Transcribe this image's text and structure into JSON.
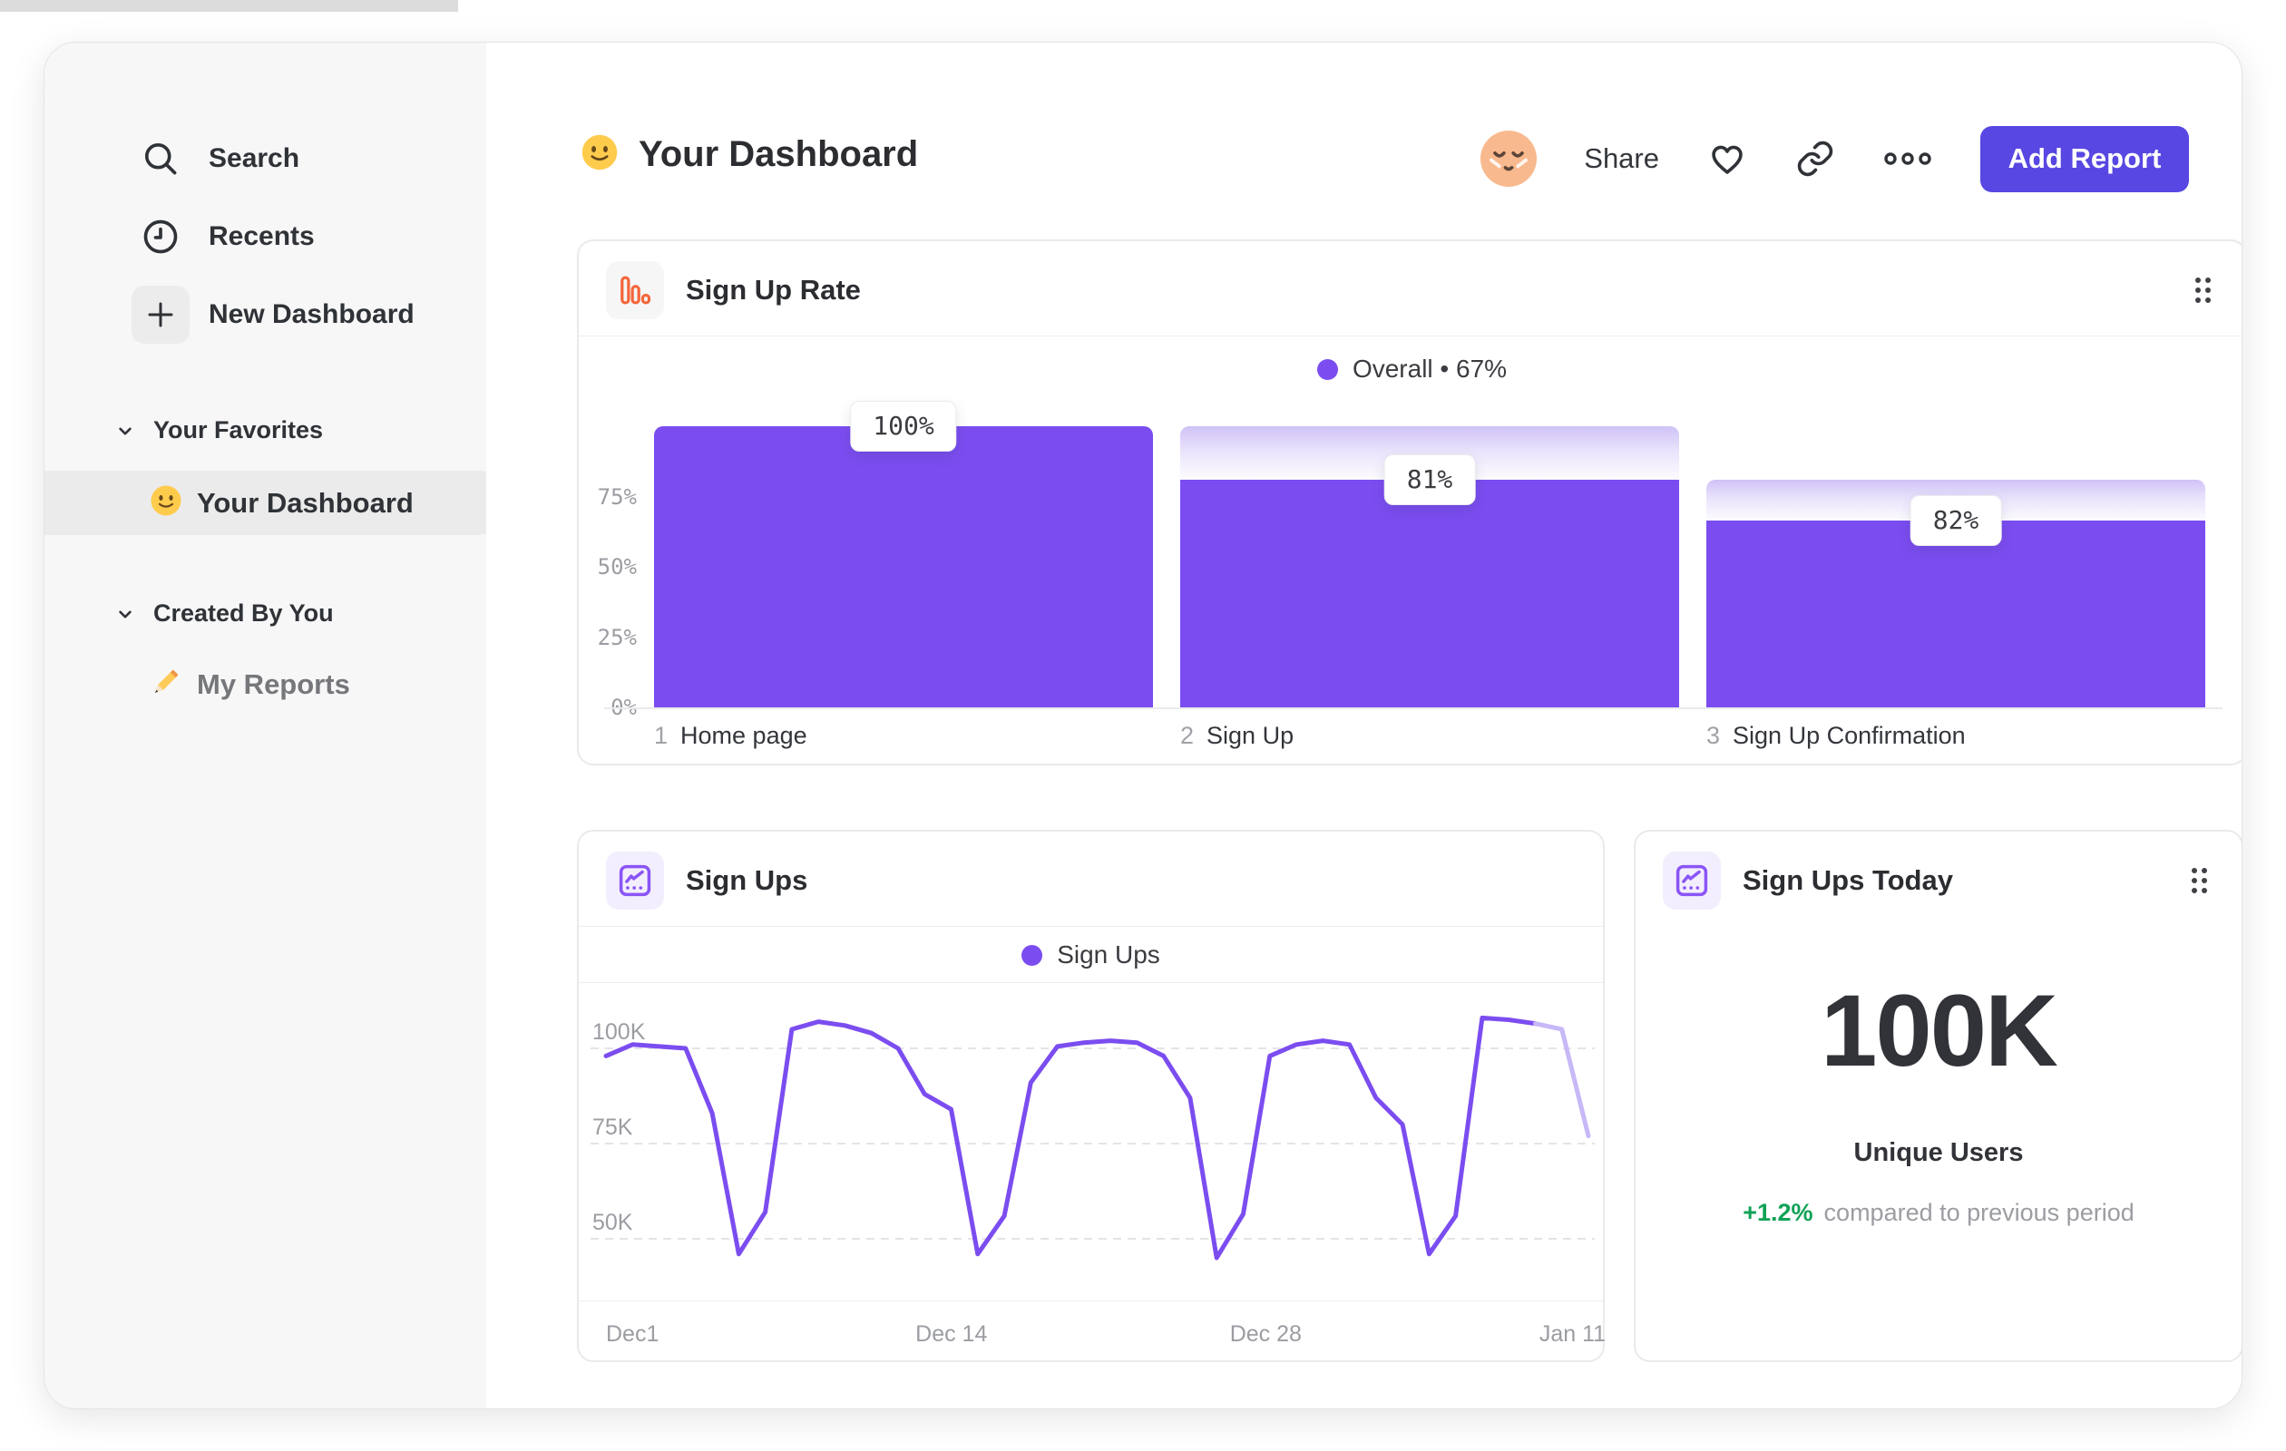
{
  "sidebar": {
    "nav": [
      {
        "icon": "search-icon",
        "label": "Search"
      },
      {
        "icon": "clock-icon",
        "label": "Recents"
      },
      {
        "icon": "plus-icon",
        "label": "New Dashboard"
      }
    ],
    "sections": [
      {
        "title": "Your Favorites",
        "items": [
          {
            "icon": "smiley-emoji",
            "label": "Your Dashboard",
            "selected": true
          }
        ]
      },
      {
        "title": "Created By You",
        "items": [
          {
            "icon": "pencil-emoji",
            "label": "My Reports",
            "selected": false
          }
        ]
      }
    ]
  },
  "header": {
    "icon": "smiley-emoji",
    "title": "Your Dashboard",
    "share": "Share",
    "add_report": "Add Report"
  },
  "funnel_card": {
    "icon": "bar-chart-icon",
    "title": "Sign Up Rate"
  },
  "line_card": {
    "icon": "insights-icon",
    "title": "Sign Ups"
  },
  "kpi_card": {
    "icon": "insights-icon",
    "title": "Sign Ups Today",
    "value": "100K",
    "metric": "Unique Users",
    "delta": "+1.2%",
    "delta_caption": "compared to previous period"
  },
  "chart_data": [
    {
      "type": "bar",
      "subtype": "funnel-steps",
      "title": "Sign Up Rate",
      "legend": {
        "series": "Overall",
        "separator": "•",
        "value_pct": 67,
        "position": "top-center"
      },
      "ylim": [
        0,
        100
      ],
      "yticks_pct": [
        75,
        50,
        25,
        0
      ],
      "grid": "off",
      "steps": [
        {
          "step": 1,
          "label": "Home page",
          "step_conversion_pct": 100,
          "cumulative_pct": 100,
          "prev_cumulative_pct": 100
        },
        {
          "step": 2,
          "label": "Sign Up",
          "step_conversion_pct": 81,
          "cumulative_pct": 81,
          "prev_cumulative_pct": 100
        },
        {
          "step": 3,
          "label": "Sign Up Confirmation",
          "step_conversion_pct": 82,
          "cumulative_pct": 66.4,
          "prev_cumulative_pct": 81
        }
      ]
    },
    {
      "type": "line",
      "title": "Sign Ups",
      "legend_position": "top-center",
      "grid": "dashed-horizontal",
      "unit": "thousands",
      "x_tick_labels": [
        "Dec1",
        "Dec 14",
        "Dec 28",
        "Jan 11"
      ],
      "x_tick_fractions": [
        0.0,
        0.315,
        0.635,
        0.95
      ],
      "ytick_values": [
        100,
        75,
        50
      ],
      "ytick_labels": [
        "100K",
        "75K",
        "50K"
      ],
      "ylim": [
        38,
        114
      ],
      "incomplete_tail_points": 2,
      "series": [
        {
          "name": "Sign Ups",
          "values": [
            98,
            101,
            100.5,
            100,
            83,
            46,
            57,
            105,
            107,
            106,
            104,
            100,
            88,
            84,
            46,
            56,
            91,
            100.5,
            101.5,
            102,
            101.5,
            98,
            87,
            45,
            56.5,
            98,
            101,
            102,
            101,
            87,
            80,
            46,
            56,
            108,
            107.5,
            106.5,
            105,
            77
          ]
        }
      ]
    },
    {
      "type": "kpi",
      "title": "Sign Ups Today",
      "value": "100K",
      "metric": "Unique Users",
      "delta_pct": "+1.2%",
      "comparison": "compared to previous period"
    }
  ],
  "colors": {
    "accent_purple": "#7b4df0",
    "tail_light_purple": "#c7b8f7",
    "button_purple": "#5847e2",
    "orange_icon": "#f4663a",
    "green_positive": "#10a256",
    "gray_text": "#9b9da2",
    "dark_text": "#2f3237",
    "sidebar_bg": "#f7f7f7",
    "selected_pill": "#ebebeb",
    "card_border": "#e9eaec"
  }
}
